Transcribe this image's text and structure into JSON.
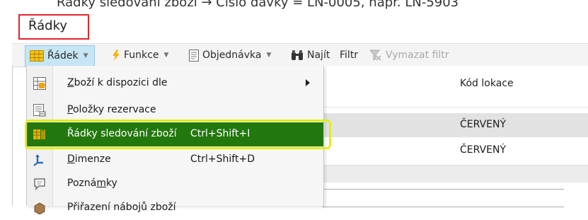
{
  "top_caption": "Řádky sledování zboží → Číslo dávky = LN-0005, např. LN-5903",
  "section": {
    "title": "Řádky"
  },
  "toolbar": {
    "row_label": "Řádek",
    "functions_label": "Funkce",
    "order_label": "Objednávka",
    "find_label": "Najít",
    "filter_label": "Filtr",
    "clear_filter_label": "Vymazat filtr"
  },
  "grid": {
    "column_header": "Kód lokace",
    "rows": [
      "ČERVENÝ",
      "ČERVENÝ"
    ]
  },
  "menu": {
    "items": [
      {
        "pre": "",
        "ul": "Z",
        "post": "boží k dispozici dle",
        "shortcut": "",
        "icon": "availability-icon",
        "submenu": true
      },
      {
        "pre": "",
        "ul": "P",
        "post": "oložky rezervace",
        "shortcut": "",
        "icon": "reservation-entries-icon"
      },
      {
        "pre": "Řádky sledování zboží",
        "ul": "",
        "post": "",
        "shortcut": "Ctrl+Shift+I",
        "icon": "item-tracking-icon",
        "highlighted": true
      },
      {
        "pre": "",
        "ul": "D",
        "post": "imenze",
        "shortcut": "Ctrl+Shift+D",
        "icon": "dimensions-icon"
      },
      {
        "pre": "Pozná",
        "ul": "m",
        "post": "ky",
        "shortcut": "",
        "icon": "comment-icon"
      },
      {
        "pre": "Přiřazení nábojů zboží",
        "ul": "",
        "post": "",
        "shortcut": "",
        "icon": "item-charge-icon"
      }
    ]
  },
  "colors": {
    "highlight": "#23780d",
    "highlight_outline": "#e2ee17",
    "section_outline": "#e0262c",
    "toolbar_active": "#c7e6f5"
  }
}
